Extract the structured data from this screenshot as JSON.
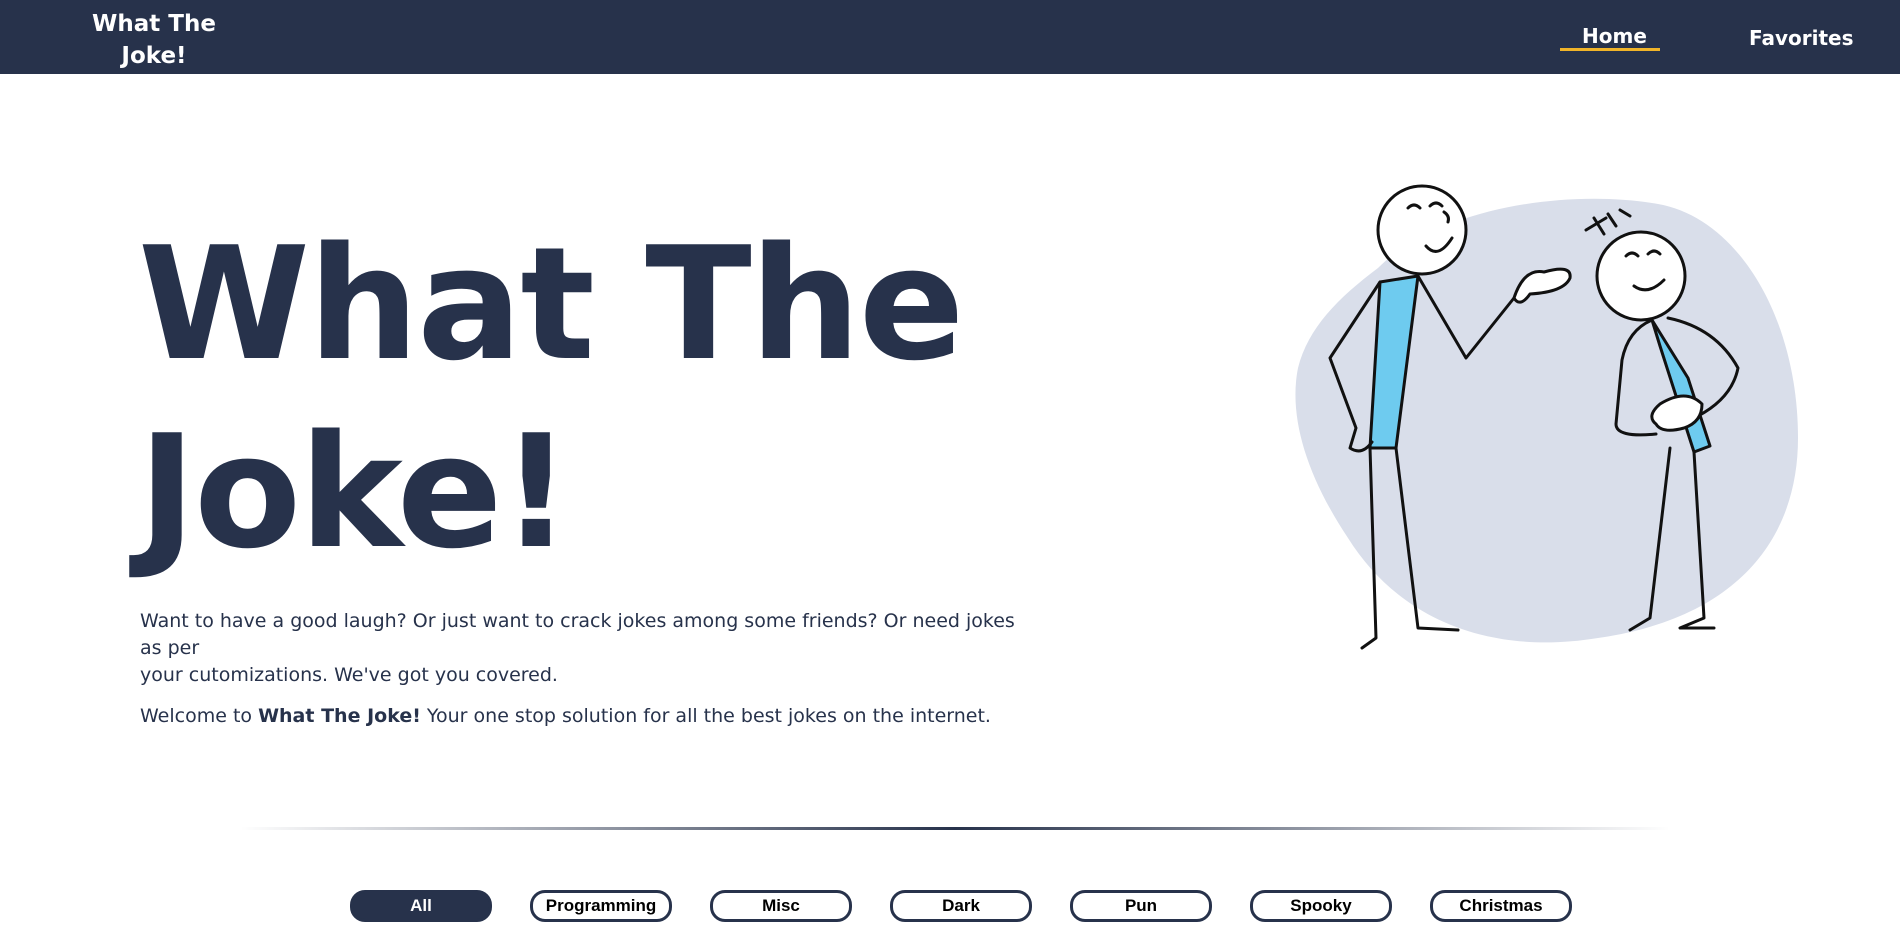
{
  "nav": {
    "brand_line1": "What The",
    "brand_line2": "Joke!",
    "links": [
      {
        "label": "Home",
        "active": true
      },
      {
        "label": "Favorites",
        "active": false
      }
    ],
    "accent_color": "#f0b429",
    "bg_color": "#27324b"
  },
  "hero": {
    "title_line1": "What The",
    "title_line2": "Joke!",
    "paragraph1_line1": "Want to have a good laugh? Or just want to crack jokes among some friends? Or need jokes as per",
    "paragraph1_line2": "your cutomizations. We've got you covered.",
    "welcome_prefix": "Welcome to",
    "welcome_brand": "What The Joke!",
    "welcome_suffix": "Your one stop solution for all the best jokes on the internet.",
    "illustration": "two-laughing-stick-figures"
  },
  "categories": {
    "items": [
      "All",
      "Programming",
      "Misc",
      "Dark",
      "Pun",
      "Spooky",
      "Christmas"
    ],
    "selected": "All"
  }
}
